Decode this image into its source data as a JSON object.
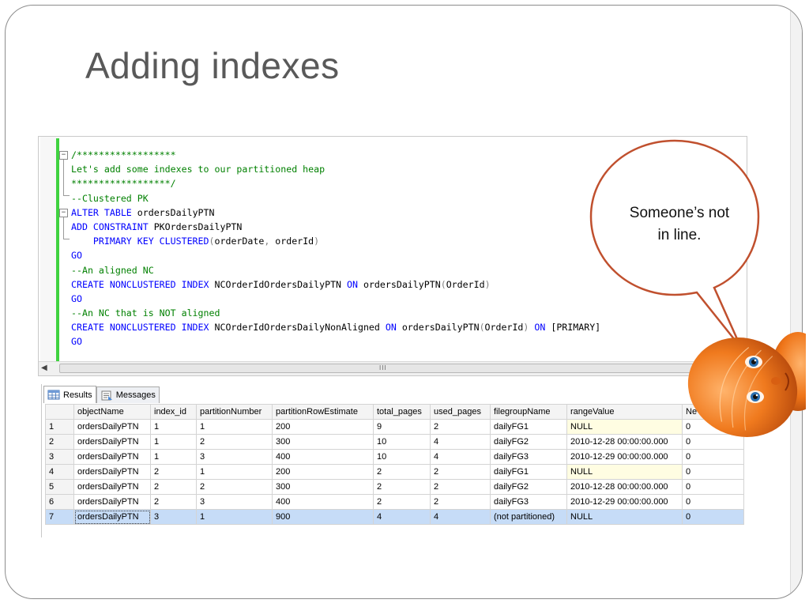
{
  "slide": {
    "title": "Adding indexes"
  },
  "editor": {
    "lines": [
      [
        {
          "t": "/******************",
          "c": "cm"
        }
      ],
      [
        {
          "t": "Let's add some indexes to our partitioned heap",
          "c": "cm"
        }
      ],
      [
        {
          "t": "******************/",
          "c": "cm"
        }
      ],
      [
        {
          "t": "--Clustered PK",
          "c": "cm"
        }
      ],
      [
        {
          "t": "ALTER TABLE ",
          "c": "kw"
        },
        {
          "t": "ordersDailyPTN",
          "c": "id"
        }
      ],
      [
        {
          "t": "ADD CONSTRAINT ",
          "c": "kw"
        },
        {
          "t": "PKOrdersDailyPTN",
          "c": "id"
        }
      ],
      [
        {
          "t": "    PRIMARY KEY CLUSTERED",
          "c": "kw"
        },
        {
          "t": "(",
          "c": "gr"
        },
        {
          "t": "orderDate",
          "c": "id"
        },
        {
          "t": ", ",
          "c": "gr"
        },
        {
          "t": "orderId",
          "c": "id"
        },
        {
          "t": ")",
          "c": "gr"
        }
      ],
      [
        {
          "t": "GO",
          "c": "kw"
        }
      ],
      [
        {
          "t": "--An aligned NC",
          "c": "cm"
        }
      ],
      [
        {
          "t": "CREATE NONCLUSTERED INDEX ",
          "c": "kw"
        },
        {
          "t": "NCOrderIdOrdersDailyPTN ",
          "c": "id"
        },
        {
          "t": "ON ",
          "c": "kw"
        },
        {
          "t": "ordersDailyPTN",
          "c": "id"
        },
        {
          "t": "(",
          "c": "gr"
        },
        {
          "t": "OrderId",
          "c": "id"
        },
        {
          "t": ")",
          "c": "gr"
        }
      ],
      [
        {
          "t": "GO",
          "c": "kw"
        }
      ],
      [
        {
          "t": "--An NC that is NOT aligned",
          "c": "cm"
        }
      ],
      [
        {
          "t": "CREATE NONCLUSTERED INDEX ",
          "c": "kw"
        },
        {
          "t": "NCOrderIdOrdersDailyNonAligned ",
          "c": "id"
        },
        {
          "t": "ON ",
          "c": "kw"
        },
        {
          "t": "ordersDailyPTN",
          "c": "id"
        },
        {
          "t": "(",
          "c": "gr"
        },
        {
          "t": "OrderId",
          "c": "id"
        },
        {
          "t": ") ",
          "c": "gr"
        },
        {
          "t": "ON ",
          "c": "kw"
        },
        {
          "t": "[PRIMARY]",
          "c": "id"
        }
      ],
      [
        {
          "t": "GO",
          "c": "kw"
        }
      ]
    ],
    "scroll_grip": "III"
  },
  "results": {
    "tabs": [
      {
        "label": "Results",
        "icon": "grid-icon",
        "active": true
      },
      {
        "label": "Messages",
        "icon": "messages-icon",
        "active": false
      }
    ],
    "columns": [
      "",
      "objectName",
      "index_id",
      "partitionNumber",
      "partitionRowEstimate",
      "total_pages",
      "used_pages",
      "filegroupName",
      "rangeValue",
      "Ne"
    ],
    "rows": [
      [
        "1",
        "ordersDailyPTN",
        "1",
        "1",
        "200",
        "9",
        "2",
        "dailyFG1",
        "NULL",
        "0"
      ],
      [
        "2",
        "ordersDailyPTN",
        "1",
        "2",
        "300",
        "10",
        "4",
        "dailyFG2",
        "2010-12-28 00:00:00.000",
        "0"
      ],
      [
        "3",
        "ordersDailyPTN",
        "1",
        "3",
        "400",
        "10",
        "4",
        "dailyFG3",
        "2010-12-29 00:00:00.000",
        "0"
      ],
      [
        "4",
        "ordersDailyPTN",
        "2",
        "1",
        "200",
        "2",
        "2",
        "dailyFG1",
        "NULL",
        "0"
      ],
      [
        "5",
        "ordersDailyPTN",
        "2",
        "2",
        "300",
        "2",
        "2",
        "dailyFG2",
        "2010-12-28 00:00:00.000",
        "0"
      ],
      [
        "6",
        "ordersDailyPTN",
        "2",
        "3",
        "400",
        "2",
        "2",
        "dailyFG3",
        "2010-12-29 00:00:00.000",
        "0"
      ],
      [
        "7",
        "ordersDailyPTN",
        "3",
        "1",
        "900",
        "4",
        "4",
        "(not partitioned)",
        "NULL",
        "0"
      ]
    ],
    "selected_row": 7
  },
  "bubble": {
    "line1": "Someone’s not",
    "line2": "in line.",
    "stroke_color": "#c0502e"
  },
  "colors": {
    "comment": "#008000",
    "keyword": "#0000ff",
    "change_bar": "#3fd23f",
    "selection": "#c6dcf7",
    "null_cell": "#fffde2"
  }
}
